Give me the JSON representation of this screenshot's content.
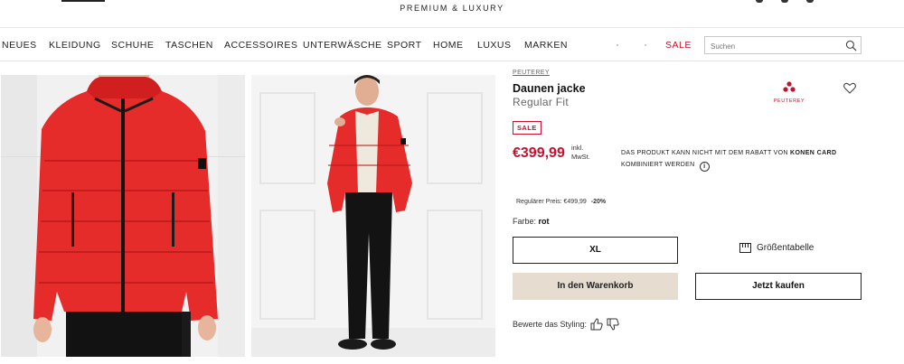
{
  "header": {
    "tagline": "PREMIUM & LUXURY"
  },
  "nav": {
    "items": [
      {
        "label": "NEUES"
      },
      {
        "label": "KLEIDUNG"
      },
      {
        "label": "SCHUHE"
      },
      {
        "label": "TASCHEN"
      },
      {
        "label": "ACCESSOIRES"
      },
      {
        "label": "UNTERWÄSCHE"
      },
      {
        "label": "SPORT"
      },
      {
        "label": "HOME"
      },
      {
        "label": "LUXUS"
      },
      {
        "label": "MARKEN"
      }
    ],
    "sale_label": "SALE",
    "search_placeholder": "Suchen"
  },
  "product": {
    "brand": "PEUTEREY",
    "brand_logo_text": "PEUTEREY",
    "title": "Daunen jacke",
    "subtitle": "Regular Fit",
    "badge": "SALE",
    "price": "€399,99",
    "vat_note": "inkl. MwSt.",
    "discount_note_prefix": "DAS PRODUKT KANN NICHT MIT DEM RABATT VON",
    "discount_card": "KONEN CARD",
    "discount_note_suffix": "KOMBINIERT WERDEN",
    "info_symbol": "i",
    "regular_price_label": "Regulärer Preis: €499,99",
    "regular_price_discount": "-20%",
    "color_label": "Farbe:",
    "color_value": "rot",
    "selected_size": "XL",
    "size_guide_label": "Größentabelle",
    "add_to_cart_label": "In den Warenkorb",
    "buy_now_label": "Jetzt kaufen",
    "rate_label": "Bewerte das Styling:"
  },
  "colors": {
    "accent_red": "#c8102e",
    "cart_button_bg": "#e6dcd0",
    "jacket_red": "#e62b2b"
  }
}
